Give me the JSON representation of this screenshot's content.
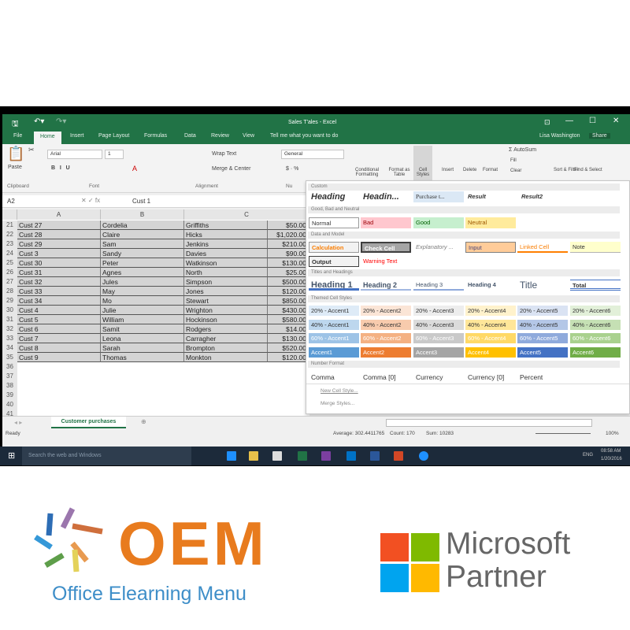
{
  "window": {
    "title": "Sales T'ales - Excel",
    "user": "Lisa Washington",
    "share": "Share",
    "tell_me": "Tell me what you want to do"
  },
  "tabs": [
    "File",
    "Home",
    "Insert",
    "Page Layout",
    "Formulas",
    "Data",
    "Review",
    "View"
  ],
  "ribbon": {
    "paste": "Paste",
    "font_name": "Arial",
    "font_size": "1",
    "wrap_text": "Wrap Text",
    "merge_center": "Merge & Center",
    "number_format": "General",
    "conditional": "Conditional Formatting",
    "format_table": "Format as Table",
    "cell_styles": "Cell Styles",
    "insert": "Insert",
    "delete": "Delete",
    "format": "Format",
    "autosum": "AutoSum",
    "fill": "Fill",
    "clear": "Clear",
    "sort_filter": "Sort & Filter",
    "find_select": "Find & Select",
    "groups": [
      "Clipboard",
      "Font",
      "Alignment",
      "Nu"
    ]
  },
  "formula_bar": {
    "name_box": "A2",
    "value": "Cust 1"
  },
  "columns": [
    "A",
    "B",
    "C"
  ],
  "rows": [
    [
      "21",
      "Cust  27",
      "Cordelia",
      "Griffiths",
      "$50.00"
    ],
    [
      "22",
      "Cust  28",
      "Claire",
      "Hicks",
      "$1,020.00"
    ],
    [
      "23",
      "Cust  29",
      "Sam",
      "Jenkins",
      "$210.00"
    ],
    [
      "24",
      "Cust  3",
      "Sandy",
      "Davies",
      "$90.00"
    ],
    [
      "25",
      "Cust  30",
      "Peter",
      "Watkinson",
      "$130.00"
    ],
    [
      "26",
      "Cust  31",
      "Agnes",
      "North",
      "$25.00"
    ],
    [
      "27",
      "Cust  32",
      "Jules",
      "Simpson",
      "$500.00"
    ],
    [
      "28",
      "Cust  33",
      "May",
      "Jones",
      "$120.00"
    ],
    [
      "29",
      "Cust  34",
      "Mo",
      "Stewart",
      "$850.00"
    ],
    [
      "30",
      "Cust  4",
      "Julie",
      "Wrighton",
      "$430.00"
    ],
    [
      "31",
      "Cust  5",
      "William",
      "Hockinson",
      "$580.00"
    ],
    [
      "32",
      "Cust  6",
      "Samit",
      "Rodgers",
      "$14.00"
    ],
    [
      "33",
      "Cust  7",
      "Leona",
      "Carragher",
      "$130.00"
    ],
    [
      "34",
      "Cust  8",
      "Sarah",
      "Brompton",
      "$520.00"
    ],
    [
      "35",
      "Cust  9",
      "Thomas",
      "Monkton",
      "$120.00"
    ]
  ],
  "empty_rows": [
    "36",
    "37",
    "38",
    "39",
    "40",
    "41"
  ],
  "gallery": {
    "sections": [
      "Custom",
      "Good, Bad and Neutral",
      "Data and Model",
      "Titles and Headings",
      "Themed Cell Styles",
      "Number Format"
    ],
    "custom": [
      "Heading",
      "Headin...",
      "Purchase t...",
      "Result",
      "Result2"
    ],
    "good_bad": [
      "Normal",
      "Bad",
      "Good",
      "Neutral"
    ],
    "data_model_1": [
      "Calculation",
      "Check Cell",
      "Explanatory ...",
      "Input",
      "Linked Cell",
      "Note"
    ],
    "data_model_2": [
      "Output",
      "Warning Text"
    ],
    "titles": [
      "Heading 1",
      "Heading 2",
      "Heading 3",
      "Heading 4",
      "Title",
      "Total"
    ],
    "accent20": [
      "20% - Accent1",
      "20% - Accent2",
      "20% - Accent3",
      "20% - Accent4",
      "20% - Accent5",
      "20% - Accent6"
    ],
    "accent40": [
      "40% - Accent1",
      "40% - Accent2",
      "40% - Accent3",
      "40% - Accent4",
      "40% - Accent5",
      "40% - Accent6"
    ],
    "accent60": [
      "60% - Accent1",
      "60% - Accent2",
      "60% - Accent3",
      "60% - Accent4",
      "60% - Accent5",
      "60% - Accent6"
    ],
    "accent": [
      "Accent1",
      "Accent2",
      "Accent3",
      "Accent4",
      "Accent5",
      "Accent6"
    ],
    "number": [
      "Comma",
      "Comma [0]",
      "Currency",
      "Currency [0]",
      "Percent"
    ],
    "menu": [
      "New Cell Style...",
      "Merge Styles..."
    ]
  },
  "colors": {
    "excel_green": "#217346",
    "accent": [
      "#5b9bd5",
      "#ed7d31",
      "#a5a5a5",
      "#ffc000",
      "#4472c4",
      "#70ad47"
    ],
    "a20": [
      "#deebf7",
      "#fbe5d6",
      "#ededed",
      "#fff2cc",
      "#dae3f3",
      "#e2f0d9"
    ],
    "a40": [
      "#bdd7ee",
      "#f8cbad",
      "#dbdbdb",
      "#ffe699",
      "#b4c7e7",
      "#c5e0b4"
    ],
    "a60": [
      "#9dc3e6",
      "#f4b183",
      "#c9c9c9",
      "#ffd966",
      "#8faadc",
      "#a9d18e"
    ]
  },
  "sheet_tab": "Customer purchases",
  "status": {
    "ready": "Ready",
    "average": "Average: 302.4411765",
    "count": "Count: 170",
    "sum": "Sum: 10283",
    "zoom": "100%"
  },
  "taskbar": {
    "search": "Search the web and Windows",
    "lang": "ENG",
    "time": "08:58 AM",
    "date": "1/20/2016"
  },
  "logos": {
    "oem": "OEM",
    "oem_sub": "Office Elearning Menu",
    "ms1": "Microsoft",
    "ms2": "Partner"
  }
}
